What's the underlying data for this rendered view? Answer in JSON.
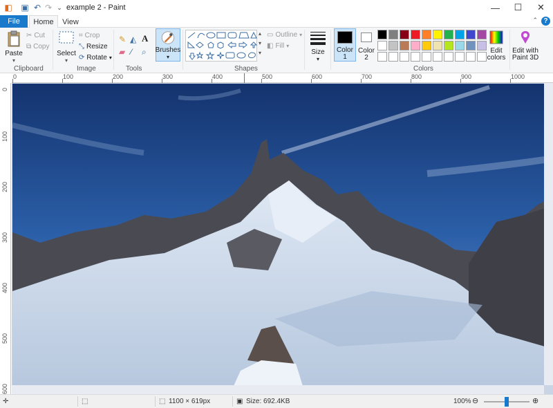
{
  "window": {
    "title": "example 2 - Paint"
  },
  "tabs": {
    "file": "File",
    "home": "Home",
    "view": "View"
  },
  "clipboard": {
    "paste": "Paste",
    "cut": "Cut",
    "copy": "Copy",
    "group": "Clipboard"
  },
  "image": {
    "select": "Select",
    "crop": "Crop",
    "resize": "Resize",
    "rotate": "Rotate",
    "group": "Image"
  },
  "tools": {
    "group": "Tools"
  },
  "brushes": {
    "label": "Brushes"
  },
  "shapes": {
    "outline": "Outline",
    "fill": "Fill",
    "group": "Shapes"
  },
  "size": {
    "label": "Size"
  },
  "colors": {
    "color1_label": "Color",
    "color1_num": "1",
    "color2_label": "Color",
    "color2_num": "2",
    "edit_line1": "Edit",
    "edit_line2": "colors",
    "p3d_line1": "Edit with",
    "p3d_line2": "Paint 3D",
    "group": "Colors",
    "color1": "#000000",
    "color2": "#ffffff",
    "palette": [
      "#000000",
      "#7f7f7f",
      "#880015",
      "#ed1c24",
      "#ff7f27",
      "#fff200",
      "#22b14c",
      "#00a2e8",
      "#3f48cc",
      "#a349a4",
      "#ffffff",
      "#c3c3c3",
      "#b97a57",
      "#ffaec9",
      "#ffc90e",
      "#efe4b0",
      "#b5e61d",
      "#99d9ea",
      "#7092be",
      "#c8bfe7",
      "#ffffff",
      "#ffffff",
      "#ffffff",
      "#ffffff",
      "#ffffff",
      "#ffffff",
      "#ffffff",
      "#ffffff",
      "#ffffff",
      "#ffffff"
    ]
  },
  "ruler": {
    "h": [
      "0",
      "100",
      "200",
      "300",
      "400",
      "500",
      "600",
      "700",
      "800",
      "900",
      "1000"
    ],
    "v": [
      "0",
      "100",
      "200",
      "300",
      "400",
      "500",
      "600"
    ]
  },
  "status": {
    "dimensions": "1100 × 619px",
    "size": "Size: 692.4KB",
    "zoom": "100%",
    "zoom_level": 0.5
  }
}
